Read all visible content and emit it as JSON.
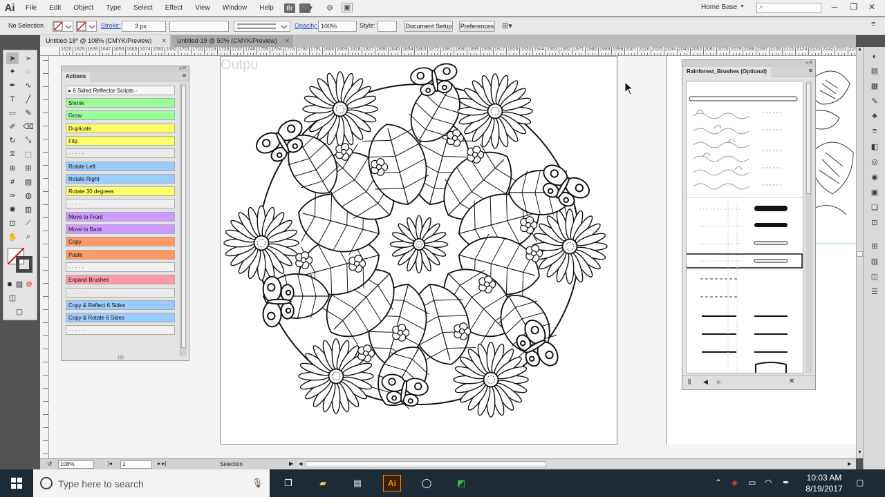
{
  "app": {
    "logo": "Ai"
  },
  "menu": [
    "File",
    "Edit",
    "Object",
    "Type",
    "Select",
    "Effect",
    "View",
    "Window",
    "Help"
  ],
  "menu_bridge": [
    "Br",
    "St"
  ],
  "workspace": {
    "label": "Home Base",
    "search_placeholder": ""
  },
  "control_bar": {
    "selection": "No Selection",
    "stroke_label": "Stroke:",
    "stroke_value": "3 px",
    "opacity_label": "Opacity:",
    "opacity_value": "100%",
    "style_label": "Style:",
    "document_setup": "Document Setup",
    "preferences": "Preferences"
  },
  "tabs": [
    {
      "label": "Untitled-18* @ 108% (CMYK/Preview)",
      "active": true
    },
    {
      "label": "Untitled-19 @ 50% (CMYK/Preview)",
      "active": false
    }
  ],
  "ruler": [
    "1620",
    "1629",
    "1638",
    "1647",
    "1656",
    "1665",
    "1674",
    "1683",
    "1692",
    "1701",
    "1710",
    "1719",
    "1728",
    "1737",
    "1746",
    "1755",
    "1764",
    "1773",
    "1782",
    "1791",
    "1800",
    "1809",
    "1818",
    "1827",
    "1836",
    "1845",
    "1854",
    "1863",
    "1872",
    "1881",
    "1890",
    "1899",
    "1908",
    "1917",
    "1926",
    "1935",
    "1944",
    "1953",
    "1962",
    "1971",
    "1980",
    "1989",
    "1998",
    "2007",
    "2016",
    "2025",
    "2034",
    "2043",
    "2052",
    "2061",
    "2070",
    "2079",
    "2088",
    "2097",
    "2106",
    "2115",
    "2124",
    "2133",
    "2142",
    "2151",
    "2160"
  ],
  "canvas": {
    "artboard_label": "Outpu"
  },
  "actions_panel": {
    "title": "Actions",
    "set_name": "6 Sided Reflector Scripts",
    "items": [
      {
        "label": "Shrink",
        "color": "#99ff99"
      },
      {
        "label": "Grow",
        "color": "#99ff99"
      },
      {
        "label": "Duplicate",
        "color": "#ffff66"
      },
      {
        "label": "Flip",
        "color": "#ffff66"
      },
      {
        "label": "- - - - -",
        "color": "#eaeaea"
      },
      {
        "label": "Rotate Left",
        "color": "#99ccff"
      },
      {
        "label": "Rotate Right",
        "color": "#99ccff"
      },
      {
        "label": "Rotate 30 degrees",
        "color": "#ffff66"
      },
      {
        "label": "- - - - -",
        "color": "#f0f0f0"
      },
      {
        "label": "Move to Front",
        "color": "#cc99ff"
      },
      {
        "label": "Move to Back",
        "color": "#cc99ff"
      },
      {
        "label": "Copy",
        "color": "#ff9966"
      },
      {
        "label": "Paste",
        "color": "#ff9966"
      },
      {
        "label": "- - - - -",
        "color": "#f0f0f0"
      },
      {
        "label": "Expand Brushes",
        "color": "#ff99aa"
      },
      {
        "label": "- - - - -",
        "color": "#eaeaea"
      },
      {
        "label": "Copy & Reflect 6 Sides",
        "color": "#99ccff"
      },
      {
        "label": "Copy & Rotate 6 Sides",
        "color": "#99ccff"
      },
      {
        "label": "- - - - -",
        "color": "#f0f0f0"
      }
    ]
  },
  "brushes_panel": {
    "title": "Rainforest_Brushes (Optional)"
  },
  "status_bar": {
    "zoom": "108%",
    "artboard": "1",
    "tool": "Selection"
  },
  "taskbar": {
    "search_placeholder": "Type here to search",
    "time": "10:03 AM",
    "date": "8/19/2017"
  }
}
